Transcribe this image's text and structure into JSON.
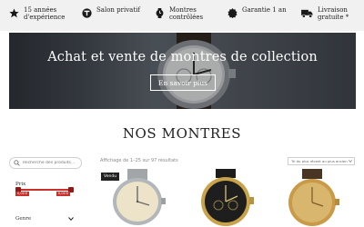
{
  "features": [
    {
      "icon": "star-icon",
      "lines": [
        "15 années",
        "d'expérience"
      ]
    },
    {
      "icon": "t-logo-icon",
      "lines": [
        "Salon privatif"
      ]
    },
    {
      "icon": "watch-icon",
      "lines": [
        "Montres",
        "contrôlées"
      ]
    },
    {
      "icon": "seal-badge-icon",
      "lines": [
        "Garantie 1 an"
      ]
    },
    {
      "icon": "delivery-truck-icon",
      "lines": [
        "Livraison",
        "gratuite *"
      ]
    }
  ],
  "hero": {
    "title": "Achat et vente de montres de collection",
    "button_label": "En savoir plus"
  },
  "section_title": "NOS MONTRES",
  "sidebar": {
    "search_placeholder": "Recherche des produits…",
    "price_label": "Prix",
    "price_min": "0,00 €",
    "price_max": "0,00 €",
    "genre_label": "Genre"
  },
  "products_header": {
    "results_text": "Affichage de 1–25 sur 97 résultats",
    "sort_label": "Tri du plus récent au plus ancien"
  },
  "badge": "Vendu",
  "colors": {
    "accent": "#c9302c",
    "topbar_bg": "#f1f1f1"
  }
}
